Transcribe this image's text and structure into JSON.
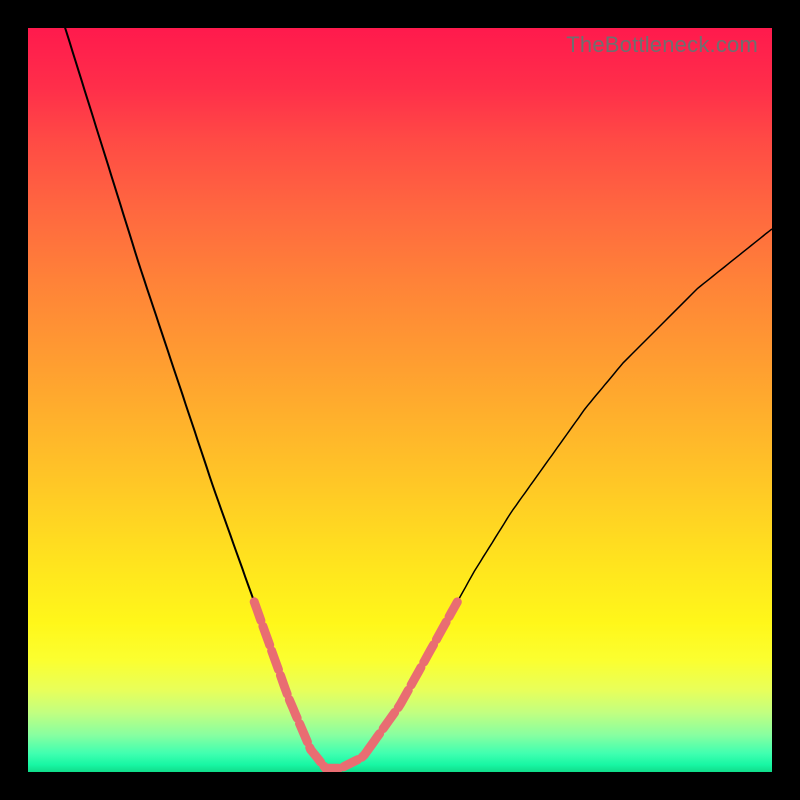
{
  "watermark": "TheBottleneck.com",
  "colors": {
    "background": "#000000",
    "curve": "#000000",
    "tolerance_band": "#e96d72",
    "gradient_top": "#ff1a4d",
    "gradient_bottom": "#10dc8a"
  },
  "chart_data": {
    "type": "line",
    "title": "",
    "xlabel": "",
    "ylabel": "",
    "xlim": [
      0,
      100
    ],
    "ylim": [
      0,
      100
    ],
    "x": [
      0,
      5,
      10,
      15,
      20,
      25,
      30,
      35,
      38,
      40,
      42,
      45,
      50,
      55,
      60,
      65,
      70,
      75,
      80,
      85,
      90,
      95,
      100
    ],
    "series": [
      {
        "name": "bottleneck-curve",
        "values": [
          115,
          100,
          84,
          68,
          53,
          38,
          24,
          10,
          3,
          0.5,
          0.5,
          2,
          9,
          18,
          27,
          35,
          42,
          49,
          55,
          60,
          65,
          69,
          73
        ]
      }
    ],
    "tolerance_band": {
      "threshold": 23,
      "x_range": [
        23,
        51
      ]
    },
    "annotations": []
  }
}
